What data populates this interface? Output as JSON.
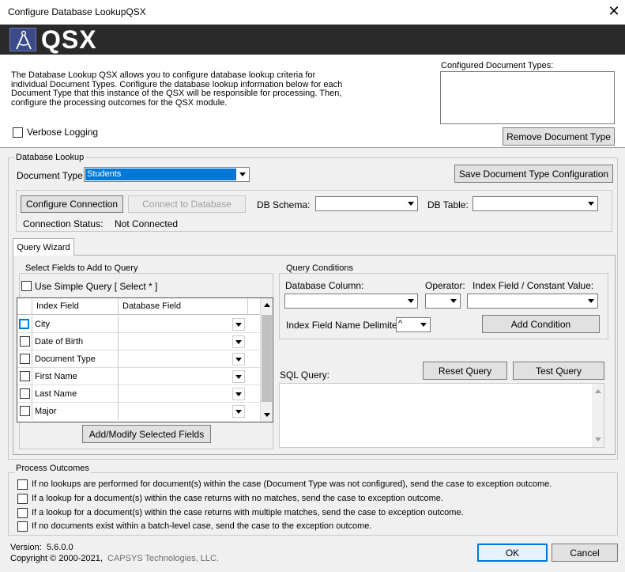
{
  "window": {
    "title": "Configure Database LookupQSX",
    "close_glyph": "✕"
  },
  "banner": {
    "logo_text": "QSX",
    "logo_icon": "compass-icon"
  },
  "header": {
    "description": "The Database Lookup QSX allows you to configure database lookup criteria for individual Document Types.  Configure the database lookup information below for each Document Type that this instance of the QSX will be responsible for processing. Then, configure the processing outcomes for the QSX module.",
    "verbose_label": "Verbose Logging",
    "configured_label": "Configured Document Types:",
    "remove_button": "Remove Document Type"
  },
  "database_lookup": {
    "group_title": "Database Lookup",
    "doc_type_label": "Document Type:",
    "doc_type_value": "Students",
    "save_button": "Save Document Type Configuration",
    "configure_button": "Configure Connection",
    "connect_button": "Connect to Database",
    "schema_label": "DB Schema:",
    "table_label": "DB Table:",
    "status_label": "Connection Status:",
    "status_value": "Not Connected"
  },
  "query_wizard": {
    "tab_label": "Query Wizard",
    "select_fields_title": "Select Fields to Add to Query",
    "simple_query_label": "Use Simple Query [ Select * ]",
    "grid_headers": [
      "Index Field",
      "Database Field"
    ],
    "rows": [
      {
        "index_field": "City"
      },
      {
        "index_field": "Date of Birth"
      },
      {
        "index_field": "Document Type"
      },
      {
        "index_field": "First Name"
      },
      {
        "index_field": "Last Name"
      },
      {
        "index_field": "Major"
      }
    ],
    "add_modify_button": "Add/Modify Selected Fields",
    "conditions_title": "Query Conditions",
    "db_column_label": "Database Column:",
    "operator_label": "Operator:",
    "index_const_label": "Index Field / Constant Value:",
    "delimiter_label": "Index Field Name Delimiter:",
    "delimiter_value": "^",
    "add_condition_button": "Add Condition",
    "sql_label": "SQL Query:",
    "reset_button": "Reset Query",
    "test_button": "Test Query"
  },
  "process_outcomes": {
    "group_title": "Process Outcomes",
    "options": [
      "If no lookups are performed for document(s) within the case (Document Type was not configured), send the case to exception outcome.",
      "If a lookup for a document(s) within the case returns with no matches, send the case to exception outcome.",
      "If a lookup for a document(s) within the case returns with multiple matches, send the case to exception outcome.",
      "If no documents exist within a batch-level case, send the case to the exception outcome."
    ]
  },
  "footer": {
    "version_label": "Version:",
    "version_value": "5.6.0.0",
    "copyright_prefix": "Copyright © 2000-2021,",
    "copyright_company": "CAPSYS Technologies, LLC.",
    "ok_button": "OK",
    "cancel_button": "Cancel"
  },
  "colors": {
    "selection": "#0078d7",
    "company_link": "#6e6e6e",
    "banner": "#2a2a2a"
  }
}
